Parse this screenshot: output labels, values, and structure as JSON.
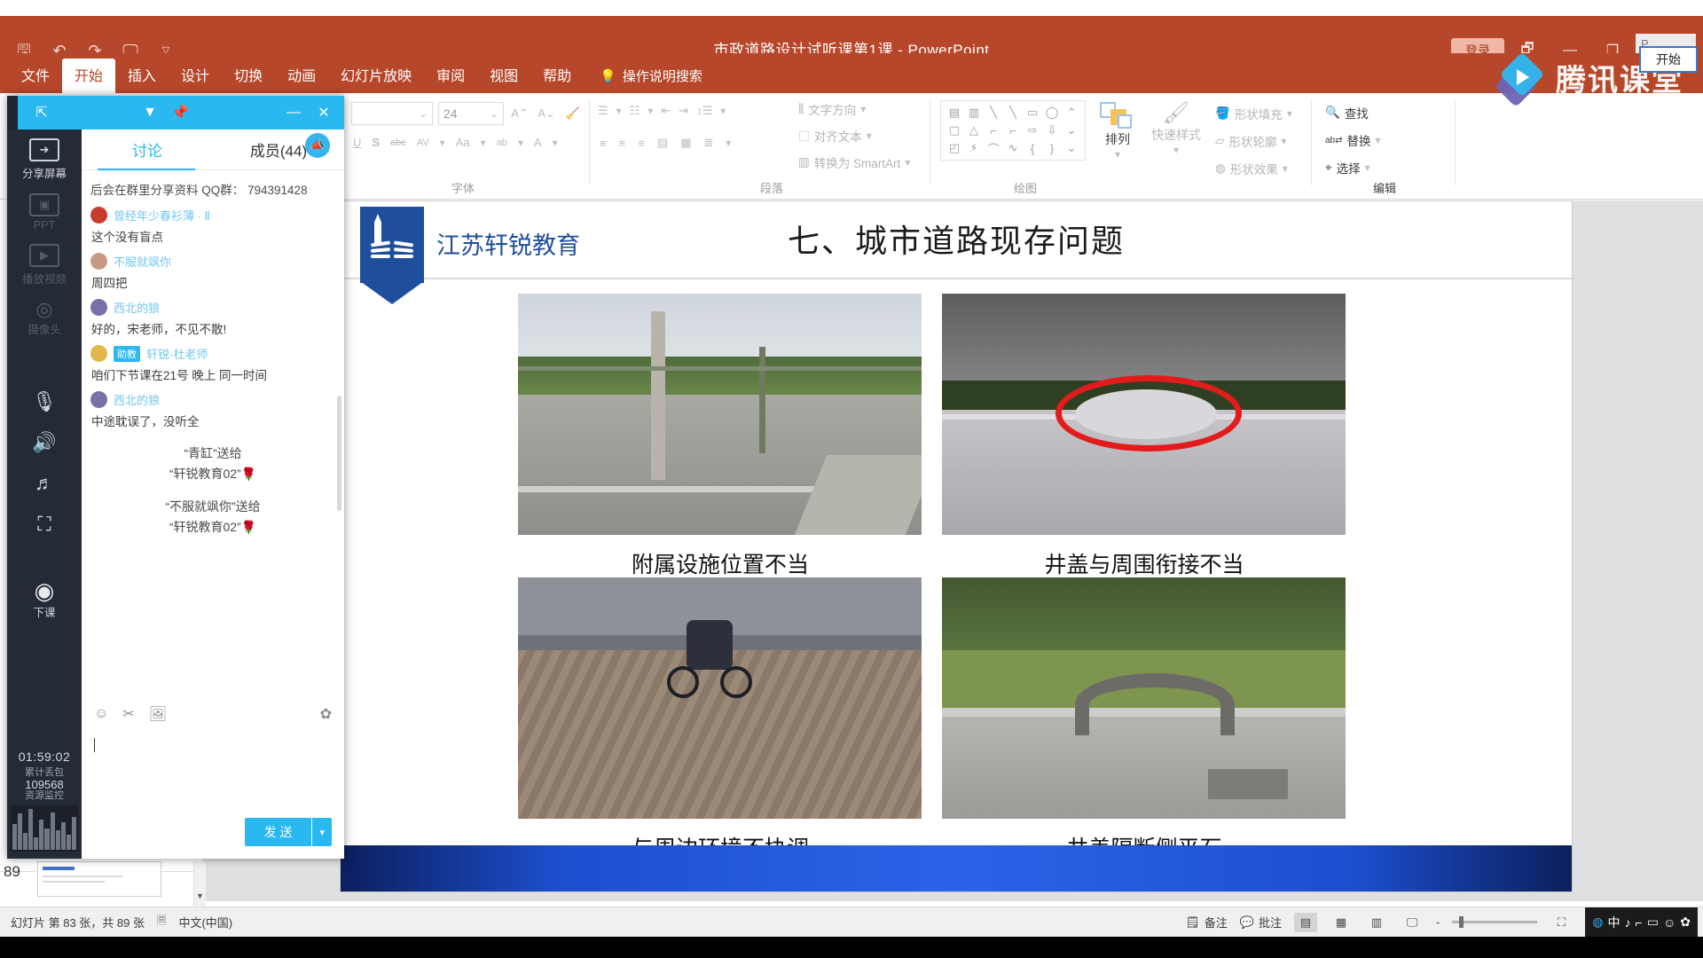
{
  "window": {
    "doc_title": "市政道路设计试听课第1课  -  PowerPoint",
    "login_label": "登录",
    "ribbon_display_icon": "ribbon-display-options-icon",
    "minimize_icon": "minimize-icon",
    "restore_icon": "restore-icon",
    "account_label": "P...",
    "start_popup_label": "开始"
  },
  "quick_access": {
    "save_icon": "save-icon",
    "undo_icon": "undo-icon",
    "redo_icon": "redo-icon",
    "slideshow_icon": "start-slideshow-icon",
    "customize_icon": "chevron-down-icon"
  },
  "ribbon": {
    "tabs": [
      {
        "label": "文件",
        "active": false
      },
      {
        "label": "开始",
        "active": true
      },
      {
        "label": "插入",
        "active": false
      },
      {
        "label": "设计",
        "active": false
      },
      {
        "label": "切换",
        "active": false
      },
      {
        "label": "动画",
        "active": false
      },
      {
        "label": "幻灯片放映",
        "active": false
      },
      {
        "label": "审阅",
        "active": false
      },
      {
        "label": "视图",
        "active": false
      },
      {
        "label": "帮助",
        "active": false
      }
    ],
    "tell_me": "操作说明搜索",
    "tell_me_icon": "lightbulb-icon",
    "groups": {
      "font": {
        "label": "字体",
        "font_name_value": "",
        "font_size_value": "24",
        "grow_font": "A",
        "shrink_font": "A",
        "clear_format_icon": "clear-formatting-icon",
        "underline": "U",
        "shadow": "S",
        "strikethrough": "abc",
        "spacing": "AV",
        "change_case": "Aa",
        "highlight": "ab",
        "font_color": "A"
      },
      "paragraph": {
        "label": "段落",
        "bullets_icon": "bulleted-list-icon",
        "numbering_icon": "numbered-list-icon",
        "decrease_indent_icon": "decrease-indent-icon",
        "increase_indent_icon": "increase-indent-icon",
        "line_spacing_icon": "line-spacing-icon",
        "align_left_icon": "align-left-icon",
        "align_center_icon": "align-center-icon",
        "align_right_icon": "align-right-icon",
        "justify_icon": "justify-icon",
        "columns_icon": "columns-icon",
        "text_direction": "文字方向",
        "align_text": "对齐文本",
        "smartart": "转换为 SmartArt"
      },
      "drawing": {
        "label": "绘图",
        "arrange": "排列",
        "quick_styles": "快速样式",
        "shape_fill": "形状填充",
        "shape_outline": "形状轮廓",
        "shape_effects": "形状效果"
      },
      "editing": {
        "label": "编辑",
        "find": "查找",
        "replace": "替换",
        "select": "选择",
        "find_icon": "search-icon",
        "replace_icon": "replace-icon",
        "select_icon": "cursor-select-icon"
      }
    }
  },
  "brand": {
    "tencent_name": "腾讯课堂",
    "tencent_logo_icon": "tencent-classroom-logo-icon"
  },
  "slide": {
    "org_name": "江苏轩锐教育",
    "title": "七、城市道路现存问题",
    "photos": [
      {
        "caption": "附属设施位置不当",
        "name": "photo-street-pole"
      },
      {
        "caption": "井盖与周围衔接不当",
        "name": "photo-manhole-cover"
      },
      {
        "caption": "与周边环境不协调",
        "name": "photo-paving-cyclist"
      },
      {
        "caption": "井盖隔断侧平石",
        "name": "photo-curb-manhole"
      }
    ]
  },
  "status_bar": {
    "slide_counter": "幻灯片 第 83 张，共 89 张",
    "spellcheck_icon": "spellcheck-icon",
    "language": "中文(中国)",
    "notes": "备注",
    "comments": "批注",
    "view_normal_icon": "normal-view-icon",
    "view_sorter_icon": "slide-sorter-icon",
    "view_reading_icon": "reading-view-icon",
    "view_slideshow_icon": "slideshow-view-icon",
    "zoom_out": "-",
    "fit_icon": "fit-to-window-icon",
    "thumb_number": "89"
  },
  "ime": {
    "mode": "中",
    "items": [
      "中",
      "♪",
      "⌐",
      "▭",
      "☺",
      "✿"
    ]
  },
  "tencent_panel": {
    "titlebar": {
      "share_icon": "share-screen-icon",
      "dropdown_icon": "chevron-down-icon",
      "pin_icon": "pin-icon",
      "minimize_icon": "minimize-icon",
      "close_icon": "close-icon"
    },
    "tools": [
      {
        "label": "分享屏幕",
        "icon": "share-screen-icon",
        "enabled": true
      },
      {
        "label": "PPT",
        "icon": "ppt-icon",
        "enabled": false
      },
      {
        "label": "播放视频",
        "icon": "play-video-icon",
        "enabled": false
      },
      {
        "label": "摄像头",
        "icon": "camera-icon",
        "enabled": false
      }
    ],
    "media_tools": [
      {
        "icon": "microphone-icon",
        "label": ""
      },
      {
        "icon": "speaker-icon",
        "label": ""
      },
      {
        "icon": "music-note-icon",
        "label": ""
      },
      {
        "icon": "fullscreen-icon",
        "label": ""
      }
    ],
    "end_class": {
      "label": "下课",
      "icon": "end-class-icon"
    },
    "timer": {
      "elapsed": "01:59:02",
      "packet_label": "累计丢包",
      "packet_value": "109568",
      "monitor_label": "资源监控"
    },
    "tabs": [
      {
        "label": "讨论",
        "active": true
      },
      {
        "label": "成员(44)",
        "active": false
      }
    ],
    "horn_icon": "announcement-icon",
    "system_line": "后会在群里分享资料  QQ群： 794391428",
    "messages": [
      {
        "user": "曾经年少春衫薄 · Ⅱ",
        "badge": "",
        "text": "这个没有盲点",
        "avatar": "#c83c2e"
      },
      {
        "user": "不服就飒你",
        "badge": "",
        "text": "周四把",
        "avatar": "#c99a82"
      },
      {
        "user": "西北的狼",
        "badge": "",
        "text": "好的，宋老师，不见不散!",
        "avatar": "#7a6fa8"
      },
      {
        "user": "轩锐·杜老师",
        "badge": "助教",
        "text": "咱们下节课在21号 晚上 同一时间",
        "avatar": "#e3b84a"
      },
      {
        "user": "西北的狼",
        "badge": "",
        "text": "中途耽误了，没听全",
        "avatar": "#7a6fa8"
      }
    ],
    "gifts": [
      {
        "line1": "“青缸”送给",
        "line2": "“轩锐教育02”",
        "rose": "🌹"
      },
      {
        "line1": "“不服就飒你”送给",
        "line2": "“轩锐教育02”",
        "rose": "🌹"
      }
    ],
    "compose": {
      "emoji_icon": "emoji-icon",
      "scissors_icon": "screenshot-icon",
      "image_icon": "image-icon",
      "settings_icon": "settings-gear-icon",
      "input_value": "",
      "send_label": "发 送",
      "send_more_icon": "chevron-down-icon"
    }
  },
  "colors": {
    "ppt_accent": "#b7472a",
    "tencent_accent": "#29b8f0",
    "slide_title": "#1a1a1a",
    "brand_blue": "#1f4e9c"
  }
}
